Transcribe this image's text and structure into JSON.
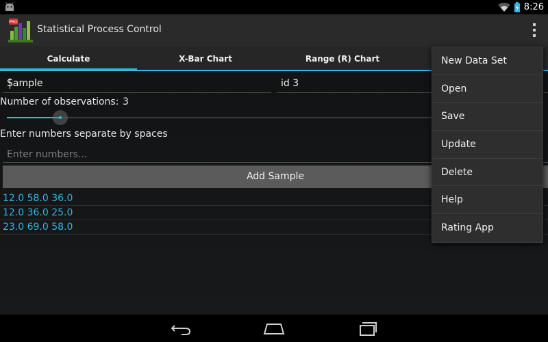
{
  "status_bar": {
    "time": "8:26"
  },
  "action_bar": {
    "title": "Statistical Process Control"
  },
  "tabs": [
    {
      "label": "Calculate",
      "active": true
    },
    {
      "label": "X-Bar Chart",
      "active": false
    },
    {
      "label": "Range (R) Chart",
      "active": false
    }
  ],
  "form": {
    "sample_name": "Sample",
    "sample_id": "id 3",
    "observations_label": "Number of observations:",
    "observations_value": "3",
    "observations_slider_fraction": 0.1,
    "enter_label": "Enter numbers separate by spaces",
    "numbers_placeholder": "Enter numbers...",
    "add_button": "Add Sample"
  },
  "samples": [
    "12.0 58.0 36.0",
    "12.0 36.0 25.0",
    "23.0 69.0 58.0"
  ],
  "menu": {
    "items": [
      "New Data Set",
      "Open",
      "Save",
      "Update",
      "Delete",
      "Help",
      "Rating App"
    ]
  },
  "colors": {
    "accent": "#33b5e5",
    "action_bar": "#2a2a2a",
    "menu_bg": "#2e2e2e"
  },
  "icons": {
    "status_left": "android-debug-icon",
    "wifi": "wifi-icon",
    "battery": "battery-charging-icon",
    "app": "spc-pro-logo-icon",
    "overflow": "overflow-menu-icon",
    "nav_back": "back-icon",
    "nav_home": "home-icon",
    "nav_recents": "recents-icon"
  }
}
